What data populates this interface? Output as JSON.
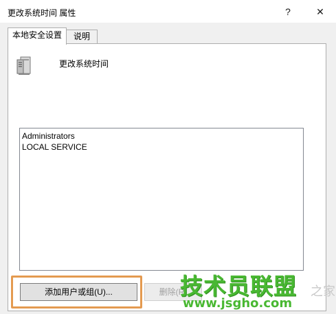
{
  "window": {
    "title": "更改系统时间 属性",
    "help_label": "?",
    "close_label": "✕"
  },
  "tabs": [
    {
      "label": "本地安全设置",
      "active": true
    },
    {
      "label": "说明",
      "active": false
    }
  ],
  "policy": {
    "icon": "server-icon",
    "name": "更改系统时间"
  },
  "principals": [
    "Administrators",
    "LOCAL SERVICE"
  ],
  "buttons": {
    "add": "添加用户或组(U)...",
    "remove": "删除(R)"
  },
  "watermark": {
    "brand": "技术员联盟",
    "side": "之家",
    "url": "www.jsgho.com"
  },
  "colors": {
    "highlight": "#e49a50",
    "watermark_green": "#49b832"
  }
}
